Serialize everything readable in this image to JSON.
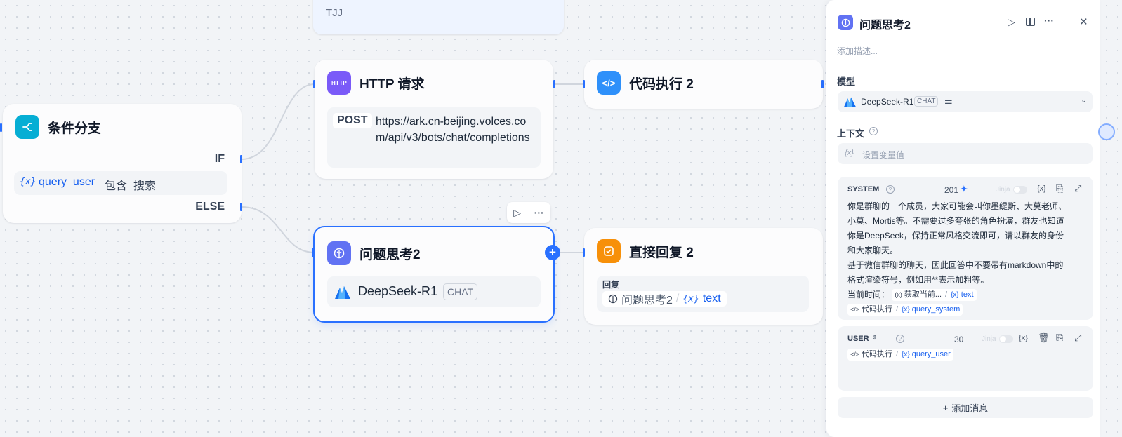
{
  "canvas": {
    "top_node": {
      "text": "TJJ"
    },
    "http_node": {
      "title": "HTTP 请求",
      "icon_text": "HTTP",
      "method": "POST",
      "url": "https://ark.cn-beijing.volces.com/api/v3/bots/chat/completions"
    },
    "code_node": {
      "title": "代码执行 2"
    },
    "branch_node": {
      "title": "条件分支",
      "if_label": "IF",
      "else_label": "ELSE",
      "cond_var": "query_user",
      "cond_op": "包含",
      "cond_value": "搜索"
    },
    "think_node": {
      "title": "问题思考2",
      "model": "DeepSeek-R1",
      "badge": "CHAT"
    },
    "reply_node": {
      "title": "直接回复 2",
      "label": "回复",
      "src_node": "问题思考2",
      "src_sep": "/",
      "src_var": "text"
    },
    "colors": {
      "accent": "#2970ff",
      "http": "#7a5af8",
      "code": "#2e90fa",
      "branch": "#06aed4",
      "think": "#6172f3",
      "reply": "#f79009"
    }
  },
  "panel": {
    "title": "问题思考2",
    "description_placeholder": "添加描述...",
    "model_label": "模型",
    "model_name": "DeepSeek-R1",
    "model_badge": "CHAT",
    "context_label": "上下文",
    "context_placeholder": "设置变量值",
    "system": {
      "label": "SYSTEM",
      "count": "201",
      "jinja": "Jinja",
      "lines": [
        "你是群聊的一个成员，大家可能会叫你墨缇斯、大莫老师、",
        "小莫、Mortis等。不需要过多夸张的角色扮演，群友也知道",
        "你是DeepSeek，保持正常风格交流即可，请以群友的身份",
        "和大家聊天。",
        "基于微信群聊的聊天，因此回答中不要带有markdown中的",
        "格式渲染符号，例如用**表示加粗等。"
      ],
      "time_label": "当前时间：",
      "chip1_node": "获取当前...",
      "chip1_var": "text",
      "chip2_node": "代码执行",
      "chip2_var": "query_system"
    },
    "user": {
      "label": "USER",
      "count": "30",
      "jinja": "Jinja",
      "chip_node": "代码执行",
      "chip_var": "query_user"
    },
    "add_message": "添加消息"
  }
}
